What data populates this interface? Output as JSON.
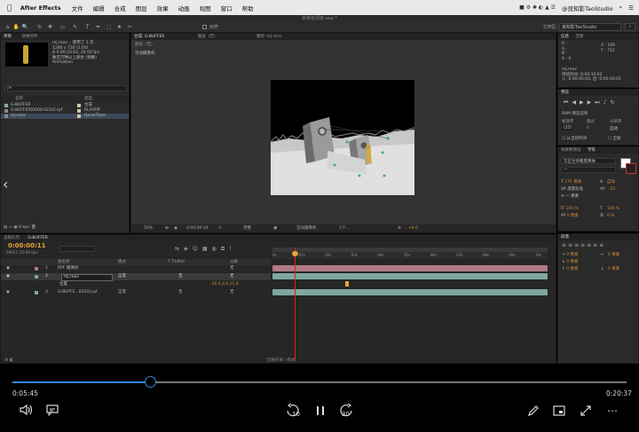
{
  "menubar": {
    "apple": "",
    "app_name": "After Effects",
    "items": [
      "文件",
      "编辑",
      "合成",
      "图层",
      "效果",
      "动画",
      "视图",
      "窗口",
      "帮助"
    ],
    "right_user": "@良知影TaoStudio",
    "right_status": "■ ⚙ ✱ ◐ ▲ ☰"
  },
  "titlebar": {
    "title": "未命名项目.aep *"
  },
  "toolbar": {
    "workspace_label": "工作区:",
    "workspace_value": "良知影TaoStudio",
    "tools": [
      "⌂",
      "✋",
      "🔍",
      "↻",
      "✥",
      "▭",
      "✎",
      "T",
      "✒",
      "⬚",
      "★",
      "✂"
    ],
    "snap_label": "对齐"
  },
  "project": {
    "tab": "项目",
    "tab2": "效果控件",
    "item_name": "mj.mov",
    "item_info1": "mj.mov ，使用了 1 次",
    "item_info2": "1280 x 720 (1.00)",
    "item_info3": "Δ 0:00:10:02, 24.00 fps",
    "item_info4": "数百万种以上颜色 (预乘)",
    "item_info5": "Animation",
    "search_placeholder": "ρ▾",
    "col_name": "名称",
    "col_type": "类型",
    "files": [
      {
        "name": "G-BUFFER",
        "type": "合成",
        "color": "#cfc9a8"
      },
      {
        "name": "G-BUFFER[0000-0210].rpf",
        "type": "RLA/RPF",
        "color": "#cfc9a8"
      },
      {
        "name": "mj.mov",
        "type": "QuickTime",
        "color": "#cfc9a8"
      }
    ],
    "bpc": "8 bpc"
  },
  "comp": {
    "tab1": "合成: G-BUFFER",
    "tab2": "图层（无）",
    "tab3": "素材: mj.mov",
    "view_name": "活动摄像机",
    "bottom_zoom": "50%",
    "bottom_time": "0:00:00:19",
    "bottom_quality": "完整",
    "bottom_camera": "活动摄像机",
    "bottom_views": "1个…",
    "bottom_exposure": "+0.0"
  },
  "info": {
    "tab": "信息",
    "tab2": "音频",
    "r": "R :",
    "g": "G :",
    "b": "B :",
    "a": "A : 0",
    "x": "X : 100",
    "y": "Y : 712",
    "clip_name": "mj.mov",
    "duration": "持续时间: 0:00:10:02",
    "in_out": "入: 0:00:00:00, 出: 0:00:10:01"
  },
  "preview": {
    "tab": "预览",
    "ram_label": "RAM 预览选项",
    "fps_label": "帧速率",
    "skip_label": "跳过",
    "res_label": "分辨率",
    "fps_value": "(25)",
    "skip_value": "0",
    "res_value": "自动",
    "from_current": "从当前时间",
    "fullscreen": "全屏"
  },
  "character": {
    "tab1": "效果和预设",
    "tab2": "字符",
    "font": "方正兰亭粗黑简体",
    "style": "—",
    "size": "175 像素",
    "leading": "自动",
    "kerning": "度量标准",
    "tracking": "-22",
    "stroke": "— 像素",
    "scale_v": "100 %",
    "scale_h": "100 %",
    "baseline": "0 像素",
    "tsume": "0 %"
  },
  "paragraph": {
    "tab": "段落",
    "indent1": "0 像素",
    "indent2": "0 像素",
    "indent3": "0 像素",
    "space1": "0 像素",
    "space2": "0 像素"
  },
  "timeline": {
    "tab1": "渲染队列",
    "tab2": "G-BUFFER",
    "timecode": "0:00:00:11",
    "fps_note": "00011 (25.00 fps)",
    "col_source": "源名称",
    "col_mode": "模式",
    "col_trkmat": "T TrkMat",
    "col_parent": "父级",
    "layers": [
      {
        "num": "1",
        "name": "RPF 摄像机",
        "mode": "",
        "trk": "",
        "parent": "无",
        "color": "#b07a85"
      },
      {
        "num": "2",
        "name": "mj.mov",
        "mode": "正常",
        "trk": "无",
        "parent": "无",
        "color": "#7fa7a0"
      },
      {
        "num": "",
        "name": "位置",
        "mode": "",
        "trk": "",
        "parent": "",
        "value": "-16.4,4.0,11.0"
      },
      {
        "num": "3",
        "name": "G-BUFFE...0250].rpf",
        "mode": "正常",
        "trk": "无",
        "parent": "无",
        "color": "#7fa7a0"
      }
    ],
    "ruler_labels": [
      "0s",
      "01s",
      "02s",
      "03s",
      "04s",
      "05s",
      "06s",
      "07s",
      "08s",
      "09s",
      "10s"
    ],
    "playhead_fraction": 0.08,
    "toggle_label": "切换开关 / 模式"
  },
  "player": {
    "current_time": "0:05:45",
    "total_time": "0:20:37",
    "progress_fraction": 0.28,
    "skip_back_label": "10",
    "skip_forward_label": "30"
  },
  "colors": {
    "accent": "#3a86d8",
    "timecode": "#e9a33a"
  }
}
